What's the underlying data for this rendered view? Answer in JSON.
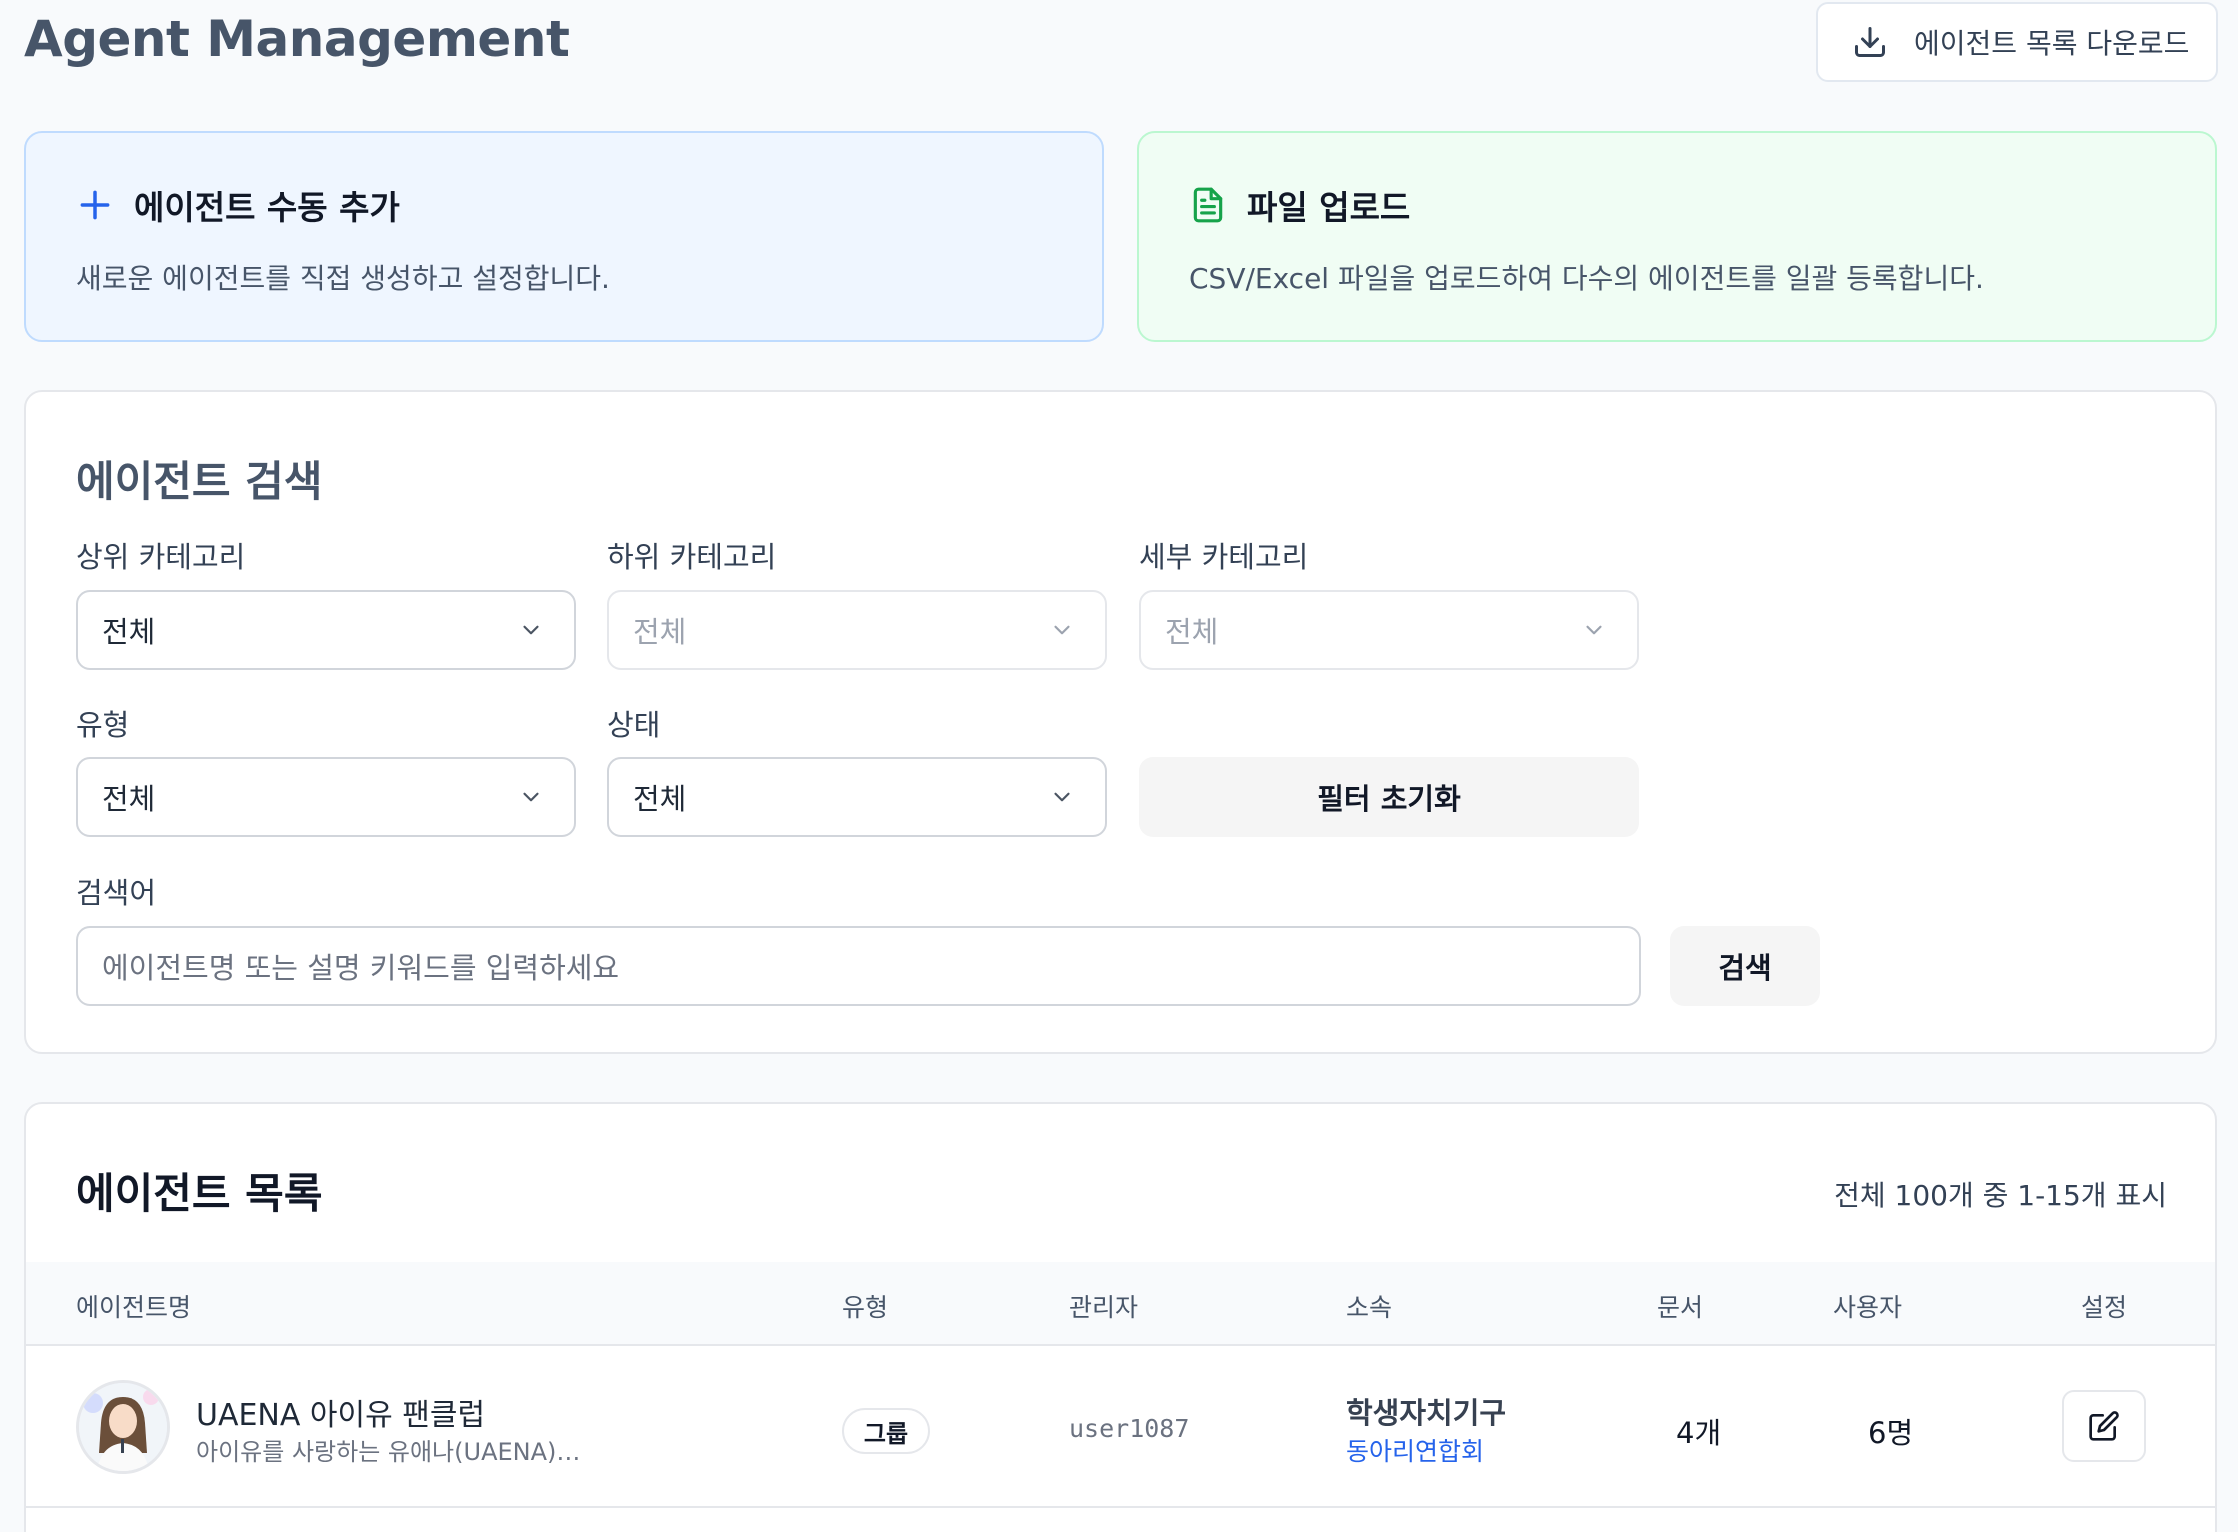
{
  "header": {
    "title": "Agent Management",
    "download_label": "에이전트 목록 다운로드"
  },
  "cards": {
    "manual": {
      "title": "에이전트 수동 추가",
      "description": "새로운 에이전트를 직접 생성하고 설정합니다.",
      "icon": "plus-icon",
      "accent": "#2563eb"
    },
    "upload": {
      "title": "파일 업로드",
      "description": "CSV/Excel 파일을 업로드하여 다수의 에이전트를 일괄 등록합니다.",
      "icon": "file-text-icon",
      "accent": "#16a34a"
    }
  },
  "search": {
    "title": "에이전트 검색",
    "filters": {
      "top_category": {
        "label": "상위 카테고리",
        "value": "전체"
      },
      "sub_category": {
        "label": "하위 카테고리",
        "value": "전체"
      },
      "detail_category": {
        "label": "세부 카테고리",
        "value": "전체"
      },
      "type": {
        "label": "유형",
        "value": "전체"
      },
      "status": {
        "label": "상태",
        "value": "전체"
      }
    },
    "reset_label": "필터 초기화",
    "keyword_label": "검색어",
    "keyword_placeholder": "에이전트명 또는 설명 키워드를 입력하세요",
    "search_label": "검색"
  },
  "list": {
    "title": "에이전트 목록",
    "count_text": "전체 100개 중 1-15개 표시",
    "columns": {
      "name": "에이전트명",
      "type": "유형",
      "manager": "관리자",
      "org": "소속",
      "docs": "문서",
      "users": "사용자",
      "settings": "설정"
    },
    "rows": [
      {
        "name": "UAENA 아이유 팬클럽",
        "description": "아이유를 사랑하는 유애나(UAENA)…",
        "type": "그룹",
        "manager": "user1087",
        "org_main": "학생자치기구",
        "org_sub": "동아리연합회",
        "docs": "4개",
        "users": "6명"
      }
    ]
  }
}
